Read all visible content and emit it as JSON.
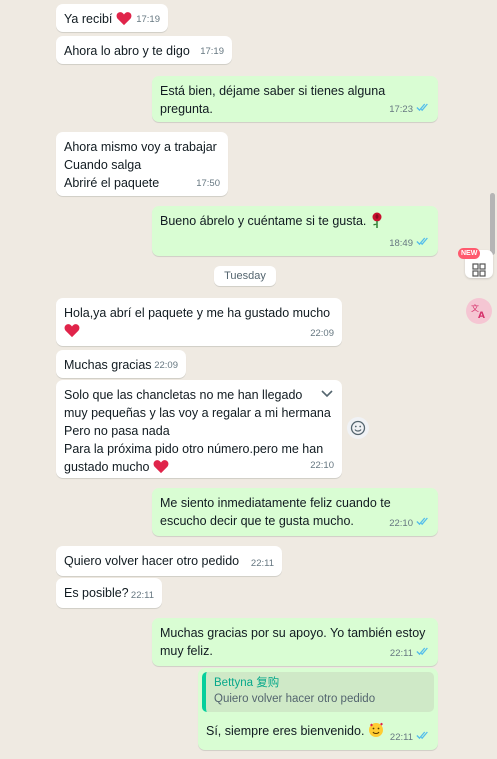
{
  "colors": {
    "background": "#efeae2",
    "incoming_bubble": "#ffffff",
    "outgoing_bubble": "#d9fdd3",
    "read_ticks": "#53bdeb",
    "heart": "#e0244a"
  },
  "messages": [
    {
      "dir": "in",
      "lines": [
        "Ya recibí"
      ],
      "emoji": "heart",
      "time": "17:19"
    },
    {
      "dir": "in",
      "lines": [
        "Ahora lo abro y te digo"
      ],
      "time": "17:19"
    },
    {
      "dir": "out",
      "lines": [
        "Está bien, déjame saber si tienes alguna",
        "pregunta."
      ],
      "time": "17:23",
      "ticks": "read"
    },
    {
      "dir": "in",
      "lines": [
        "Ahora mismo voy a trabajar",
        "Cuando salga",
        "Abriré el paquete"
      ],
      "time": "17:50"
    },
    {
      "dir": "out",
      "lines": [
        "Bueno ábrelo y cuéntame si te gusta."
      ],
      "emoji": "rose",
      "time": "18:49",
      "ticks": "read"
    },
    {
      "dir": "in",
      "lines": [
        "Hola,ya abrí el paquete y me ha gustado mucho"
      ],
      "emoji": "heart",
      "time": "22:09"
    },
    {
      "dir": "in",
      "lines": [
        "Muchas gracias"
      ],
      "time": "22:09"
    },
    {
      "dir": "in",
      "lines": [
        "Solo que las chancletas no me han llegado",
        "muy pequeñas y las voy a regalar a mi hermana",
        "Pero no pasa nada",
        "Para la próxima pido otro número.pero me han",
        "gustado mucho"
      ],
      "emoji": "heart",
      "time": "22:10"
    },
    {
      "dir": "out",
      "lines": [
        "Me siento inmediatamente feliz cuando te",
        "escucho decir que te gusta mucho."
      ],
      "time": "22:10",
      "ticks": "read"
    },
    {
      "dir": "in",
      "lines": [
        "Quiero volver hacer otro pedido"
      ],
      "time": "22:11"
    },
    {
      "dir": "in",
      "lines": [
        "Es posible?"
      ],
      "time": "22:11"
    },
    {
      "dir": "out",
      "lines": [
        "Muchas gracias por su apoyo. Yo también estoy",
        "muy feliz."
      ],
      "time": "22:11",
      "ticks": "read"
    },
    {
      "dir": "out",
      "quote": {
        "author": "Bettyna 复购",
        "text": "Quiero volver hacer otro pedido"
      },
      "lines": [
        "Sí, siempre eres bienvenido."
      ],
      "emoji": "smiling-hearts",
      "time": "22:11",
      "ticks": "read"
    }
  ],
  "day_separator": "Tuesday",
  "side_panel": {
    "new_badge": "NEW",
    "icons": [
      "apps-grid-icon",
      "translate-icon"
    ]
  }
}
